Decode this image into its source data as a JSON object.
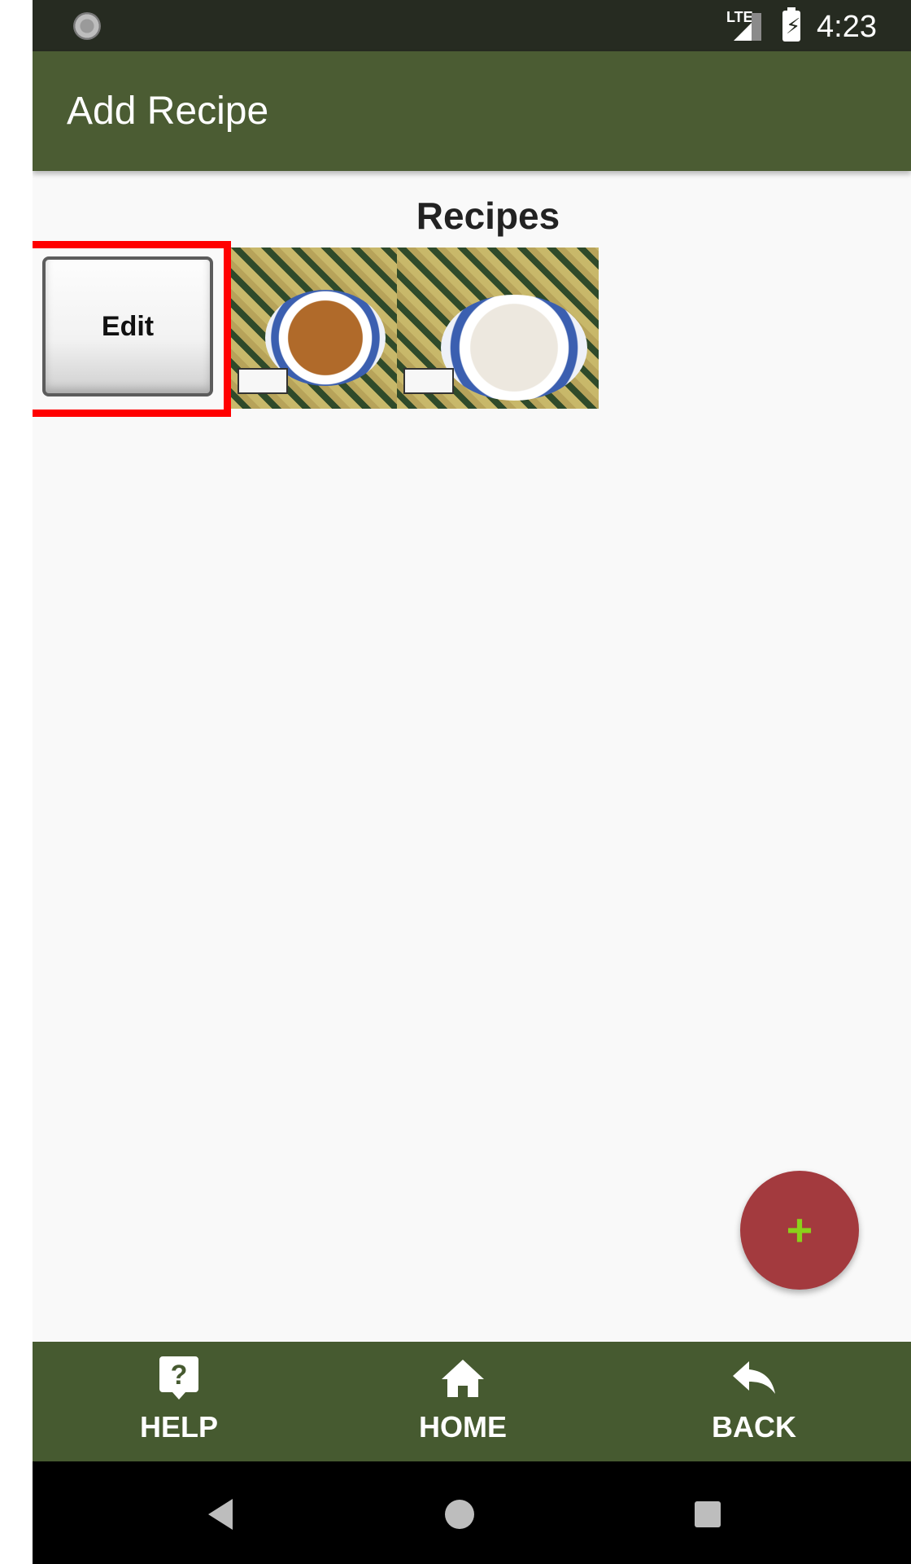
{
  "status_bar": {
    "network": "LTE",
    "time": "4:23",
    "icons": [
      "loading-icon",
      "signal-icon",
      "battery-charging-icon"
    ]
  },
  "app_bar": {
    "title": "Add Recipe"
  },
  "main": {
    "section_title": "Recipes",
    "edit_button_label": "Edit",
    "recipes": [
      {
        "image": "recipe-photo-bean-stew"
      },
      {
        "image": "recipe-photo-rice"
      }
    ],
    "fab": {
      "icon": "plus-icon",
      "label": "+"
    }
  },
  "bottom_nav": {
    "items": [
      {
        "label": "HELP",
        "icon": "help-icon"
      },
      {
        "label": "HOME",
        "icon": "home-icon"
      },
      {
        "label": "BACK",
        "icon": "reply-icon"
      }
    ]
  },
  "system_nav": {
    "buttons": [
      "back-triangle-icon",
      "home-circle-icon",
      "recents-square-icon"
    ]
  },
  "colors": {
    "status_bar": "#262b21",
    "app_bar": "#4b5c33",
    "bottom_nav": "#465a30",
    "fab": "#a33a3e",
    "fab_icon": "#8ad11a",
    "highlight": "#ff0000"
  }
}
